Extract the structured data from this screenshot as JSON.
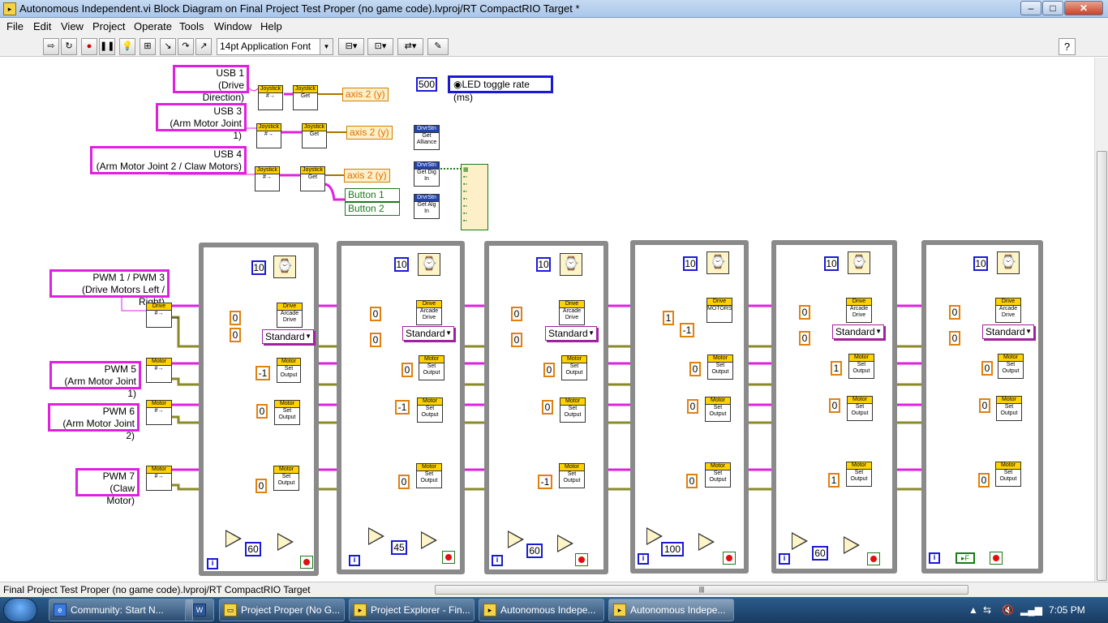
{
  "window": {
    "title": "Autonomous Independent.vi Block Diagram on Final Project Test Proper (no game code).lvproj/RT CompactRIO Target *"
  },
  "menu": [
    "File",
    "Edit",
    "View",
    "Project",
    "Operate",
    "Tools",
    "Window",
    "Help"
  ],
  "toolbar": {
    "font": "14pt Application Font",
    "vi_icon": "Auto Indep"
  },
  "labels": {
    "usb1": [
      "USB 1",
      "(Drive Direction)"
    ],
    "usb3": [
      "USB 3",
      "(Arm Motor Joint 1)"
    ],
    "usb4": [
      "USB 4",
      "(Arm Motor Joint 2 / Claw Motors)"
    ],
    "pwm13": [
      "PWM 1 / PWM 3",
      "(Drive Motors Left / Right)"
    ],
    "pwm5": [
      "PWM 5",
      "(Arm Motor Joint 1)"
    ],
    "pwm6": [
      "PWM 6",
      "(Arm Motor Joint 2)"
    ],
    "pwm7": [
      "PWM 7",
      "(Claw Motor)"
    ]
  },
  "vis": {
    "joystick": "Joystick",
    "get": "Get",
    "drvstn": "DrvrStn",
    "get_alliance": "Get Alliance",
    "get_dig_in": "Get Dig In",
    "get_alg_in": "Get Alg In",
    "drive": "Drive",
    "arcade_drive": "Arcade Drive",
    "motors": "MOTORS",
    "motor": "Motor",
    "set_output": "Set Output"
  },
  "indicators": {
    "axis2": "axis 2 (y)",
    "button1": "Button 1",
    "button2": "Button 2"
  },
  "led": {
    "value": "500",
    "label": "LED toggle rate (ms)"
  },
  "frames": [
    {
      "wait": "10",
      "arcade": [
        "0",
        "0"
      ],
      "mode": "Standard",
      "m5": "-1",
      "m6": "0",
      "m7": "0",
      "count": "60"
    },
    {
      "wait": "10",
      "arcade": [
        "0",
        "0"
      ],
      "mode": "Standard",
      "m5": "0",
      "m6": "-1",
      "m7": "0",
      "count": "45"
    },
    {
      "wait": "10",
      "arcade": [
        "0",
        "0"
      ],
      "mode": "Standard",
      "m5": "0",
      "m6": "0",
      "m7": "-1",
      "count": "60"
    },
    {
      "wait": "10",
      "arcade": [
        "1",
        "-1"
      ],
      "mode": "",
      "m5": "0",
      "m6": "0",
      "m7": "0",
      "count": "100"
    },
    {
      "wait": "10",
      "arcade": [
        "0",
        "0"
      ],
      "mode": "Standard",
      "m5": "1",
      "m6": "0",
      "m7": "1",
      "count": "60"
    },
    {
      "wait": "10",
      "arcade": [
        "0",
        "0"
      ],
      "mode": "Standard",
      "m5": "0",
      "m6": "0",
      "m7": "0",
      "count": ""
    }
  ],
  "last_frame_const": "F",
  "status": {
    "path": "Final Project Test Proper (no game code).lvproj/RT CompactRIO Target"
  },
  "taskbar": {
    "tasks": [
      "Community: Start N...",
      "Project Proper (No G...",
      "Project Explorer - Fin...",
      "Autonomous Indepe...",
      "Autonomous Indepe..."
    ],
    "time": "7:05 PM"
  }
}
